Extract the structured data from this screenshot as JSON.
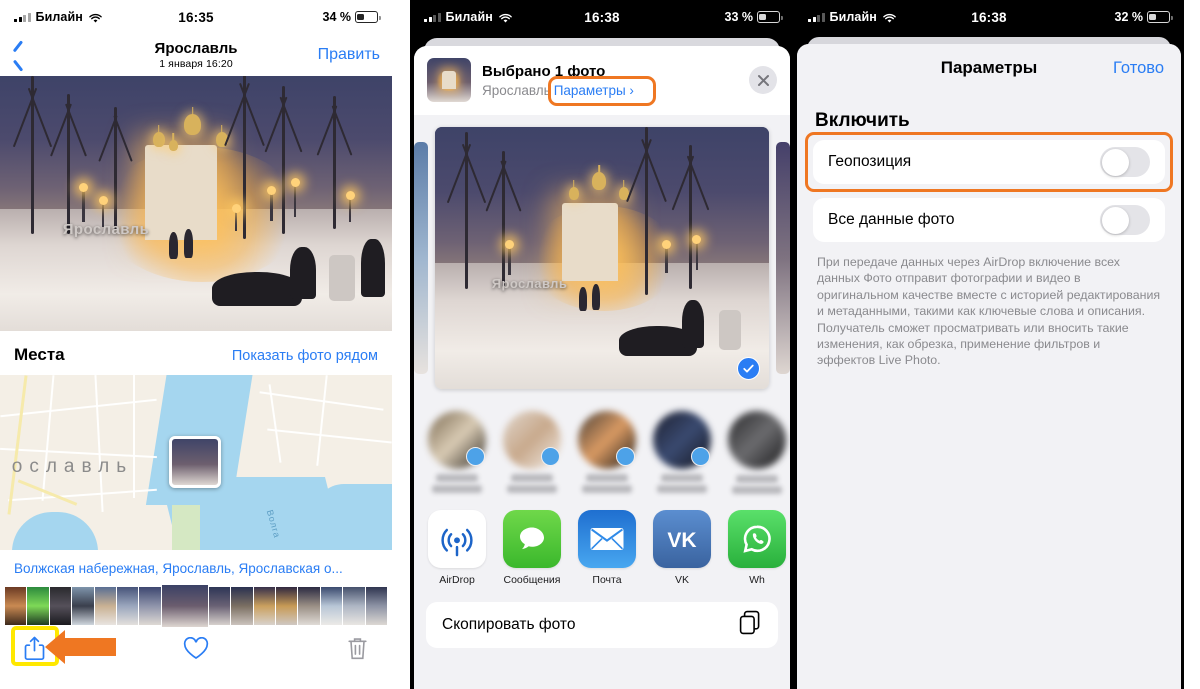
{
  "phone1": {
    "status": {
      "carrier": "Билайн",
      "time": "16:35",
      "battery_text": "34 %",
      "battery_pct": 34
    },
    "nav": {
      "back_icon": "chevron-left-icon",
      "title": "Ярославль",
      "subtitle": "1 января  16:20",
      "edit": "Править"
    },
    "places": {
      "title": "Места",
      "link": "Показать фото рядом"
    },
    "map": {
      "city_label": "ославль",
      "river_label": "Волга"
    },
    "address": "Волжская набережная, Ярославль, Ярославская о...",
    "toolbar": {
      "share_icon": "share-icon",
      "favorite_icon": "heart-icon",
      "delete_icon": "trash-icon"
    },
    "annotation": {
      "highlight_color": "#ffe800",
      "arrow_color": "#ef7722"
    }
  },
  "phone2": {
    "status": {
      "carrier": "Билайн",
      "time": "16:38",
      "battery_text": "33 %",
      "battery_pct": 33
    },
    "sheet_head": {
      "title": "Выбрано 1 фото",
      "subtitle": "Ярославль",
      "options_label": "Параметры ›",
      "close_icon": "close-icon"
    },
    "preview": {
      "selected_icon": "checkmark-circle-icon"
    },
    "contacts": [
      {
        "name_hidden": true
      },
      {
        "name_hidden": true
      },
      {
        "name_hidden": true
      },
      {
        "name_hidden": true
      },
      {
        "name_hidden": true
      }
    ],
    "apps": [
      {
        "label": "AirDrop",
        "icon": "airdrop-icon",
        "color": "#ffffff"
      },
      {
        "label": "Сообщения",
        "icon": "messages-icon",
        "color": "#5bc236"
      },
      {
        "label": "Почта",
        "icon": "mail-icon",
        "color": "#2f8ae8"
      },
      {
        "label": "VK",
        "icon": "vk-icon",
        "color": "#4b7bbd"
      },
      {
        "label": "Wh",
        "icon": "whatsapp-icon",
        "color": "#49c95a"
      }
    ],
    "actions": {
      "copy_label": "Скопировать фото",
      "copy_icon": "copy-icon"
    },
    "annotation": {
      "highlight_color": "#ef7722"
    }
  },
  "phone3": {
    "status": {
      "carrier": "Билайн",
      "time": "16:38",
      "battery_text": "32 %",
      "battery_pct": 32
    },
    "nav": {
      "title": "Параметры",
      "done": "Готово"
    },
    "section_title": "Включить",
    "rows": [
      {
        "label": "Геопозиция",
        "enabled": false,
        "highlighted": true
      },
      {
        "label": "Все данные фото",
        "enabled": false,
        "highlighted": false
      }
    ],
    "description": "При передаче данных через AirDrop включение всех данных Фото отправит фотографии и видео в оригинальном качестве вместе с историей редактирования и метаданными, такими как ключевые слова и описания. Получатель сможет просматривать или вносить такие изменения, как обрезка, применение фильтров и эффектов Live Photo.",
    "annotation": {
      "highlight_color": "#ef7722"
    }
  }
}
